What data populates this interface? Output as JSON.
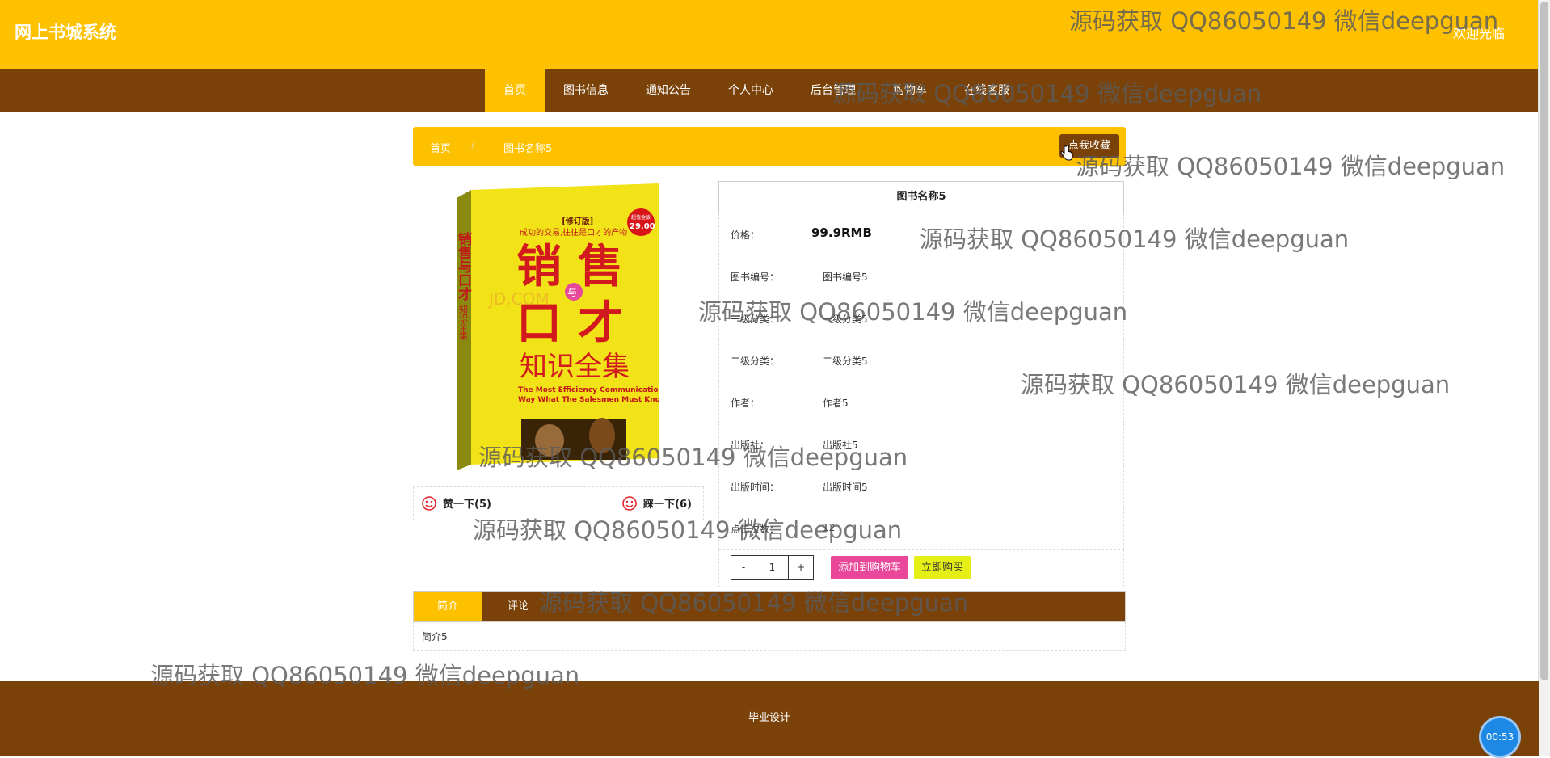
{
  "header": {
    "site_title": "网上书城系统",
    "welcome": "欢迎光临"
  },
  "nav": {
    "items": [
      {
        "label": "首页",
        "active": true
      },
      {
        "label": "图书信息",
        "active": false
      },
      {
        "label": "通知公告",
        "active": false
      },
      {
        "label": "个人中心",
        "active": false
      },
      {
        "label": "后台管理",
        "active": false
      },
      {
        "label": "购物车",
        "active": false
      },
      {
        "label": "在线客服",
        "active": false
      }
    ]
  },
  "breadcrumb": {
    "home": "首页",
    "separator": "/",
    "current": "图书名称5",
    "favorite_button": "点我收藏"
  },
  "book": {
    "cover": {
      "edition": "[修订版]",
      "tagline": "成功的交易,往往是口才的产物",
      "badge_label": "超值金版",
      "badge_price": "29.00",
      "title_chars": [
        "销",
        "售",
        "与",
        "口",
        "才"
      ],
      "subtitle": "知识全集",
      "english_line1": "The Most Efficiency Communication",
      "english_line2": "Way What The Salesmen Must Know",
      "spine_title": "销售与口才",
      "spine_sub": "知识全集",
      "watermark": "JD.COM"
    },
    "like_label": "赞一下(5)",
    "dislike_label": "踩一下(6)",
    "title": "图书名称5",
    "price_label": "价格：",
    "price_value": "99.9RMB",
    "fields": [
      {
        "label": "图书编号：",
        "value": "图书编号5"
      },
      {
        "label": "一级分类：",
        "value": "一级分类5"
      },
      {
        "label": "二级分类：",
        "value": "二级分类5"
      },
      {
        "label": "作者：",
        "value": "作者5"
      },
      {
        "label": "出版社：",
        "value": "出版社5"
      },
      {
        "label": "出版时间：",
        "value": "出版时间5"
      },
      {
        "label": "点击次数：",
        "value": "12"
      }
    ],
    "quantity": {
      "minus": "-",
      "value": "1",
      "plus": "+"
    },
    "add_to_cart": "添加到购物车",
    "buy_now": "立即购买"
  },
  "tabs": {
    "items": [
      {
        "label": "简介",
        "active": true
      },
      {
        "label": "评论",
        "active": false
      }
    ],
    "panel_text": "简介5"
  },
  "footer": {
    "text": "毕业设计"
  },
  "timer": "00:53",
  "watermark_text": "源码获取 QQ86050149 微信deepguan",
  "colors": {
    "primary_yellow": "#fdc100",
    "primary_brown": "#7a4209",
    "cart_pink": "#e8479a",
    "buy_yellow": "#e6ef15"
  }
}
